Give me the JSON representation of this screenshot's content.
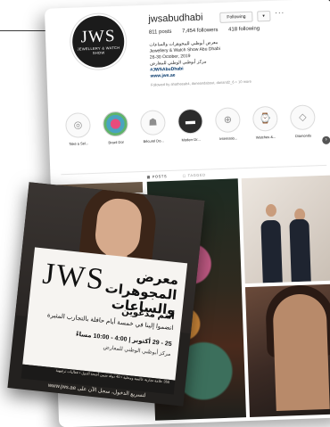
{
  "profile": {
    "logo_text": "JWS",
    "logo_sub": "JEWELLERY & WATCH SHOW",
    "handle": "jwsabudhabi",
    "following_button": "Following",
    "chevron_button": "▾",
    "more_label": "···",
    "stats": {
      "posts": "811 posts",
      "followers": "7,454 followers",
      "following": "418 following"
    },
    "bio": {
      "line1_ar": "معرض أبوظبي للمجوهرات والساعات",
      "line2": "Jewellery & Watch Show Abu Dhabi",
      "line3": "26-30 October, 2019",
      "line4_ar": "مركز أبوظبي الوطني للمعارض",
      "hashtag": "#JWSAbuDhabi",
      "website": "www.jws.ae",
      "followed_by": "Followed by ahatheeab4, doneandabout, danand2_6 + 10 more"
    }
  },
  "highlights": [
    {
      "label": "Take a Sel...",
      "icon": "◎",
      "style": "light"
    },
    {
      "label": "Brazil Dor",
      "icon": "✿",
      "style": "flower"
    },
    {
      "label": "Bécurel Do...",
      "icon": "☗",
      "style": "light"
    },
    {
      "label": "Moderr Dr...",
      "icon": "▬",
      "style": "dark"
    },
    {
      "label": "Internatio...",
      "icon": "⊕",
      "style": "light"
    },
    {
      "label": "Watches &...",
      "icon": "⌚",
      "style": "light"
    },
    {
      "label": "Diamonds",
      "icon": "◇",
      "style": "light"
    }
  ],
  "highlight_next_icon": "›",
  "tabs": {
    "posts": "▦ POSTS",
    "tagged": "▢ TAGGED"
  },
  "promo": {
    "logo": "JWS",
    "title_ar": "معرض المجوهرات والساعات",
    "invite_ar": "أنتم مدعوين",
    "join_ar": "انضموا إلينا في خمسة أيام حافلة بالتجارب المثيرة",
    "dates_ar": "25 - 29 أكتوبر | 4:00 - 10:00 مساءً",
    "venue_ar": "مركز أبوظبي الوطني للمعارض",
    "info_ar": "350 علامة تجارية عالمية ومحلية • 40 دولة ضمن أجنحة الدول • فعاليات ترفيهية",
    "web_ar": "لتسريع الدخول، سجل الآن على www.jws.ae"
  }
}
